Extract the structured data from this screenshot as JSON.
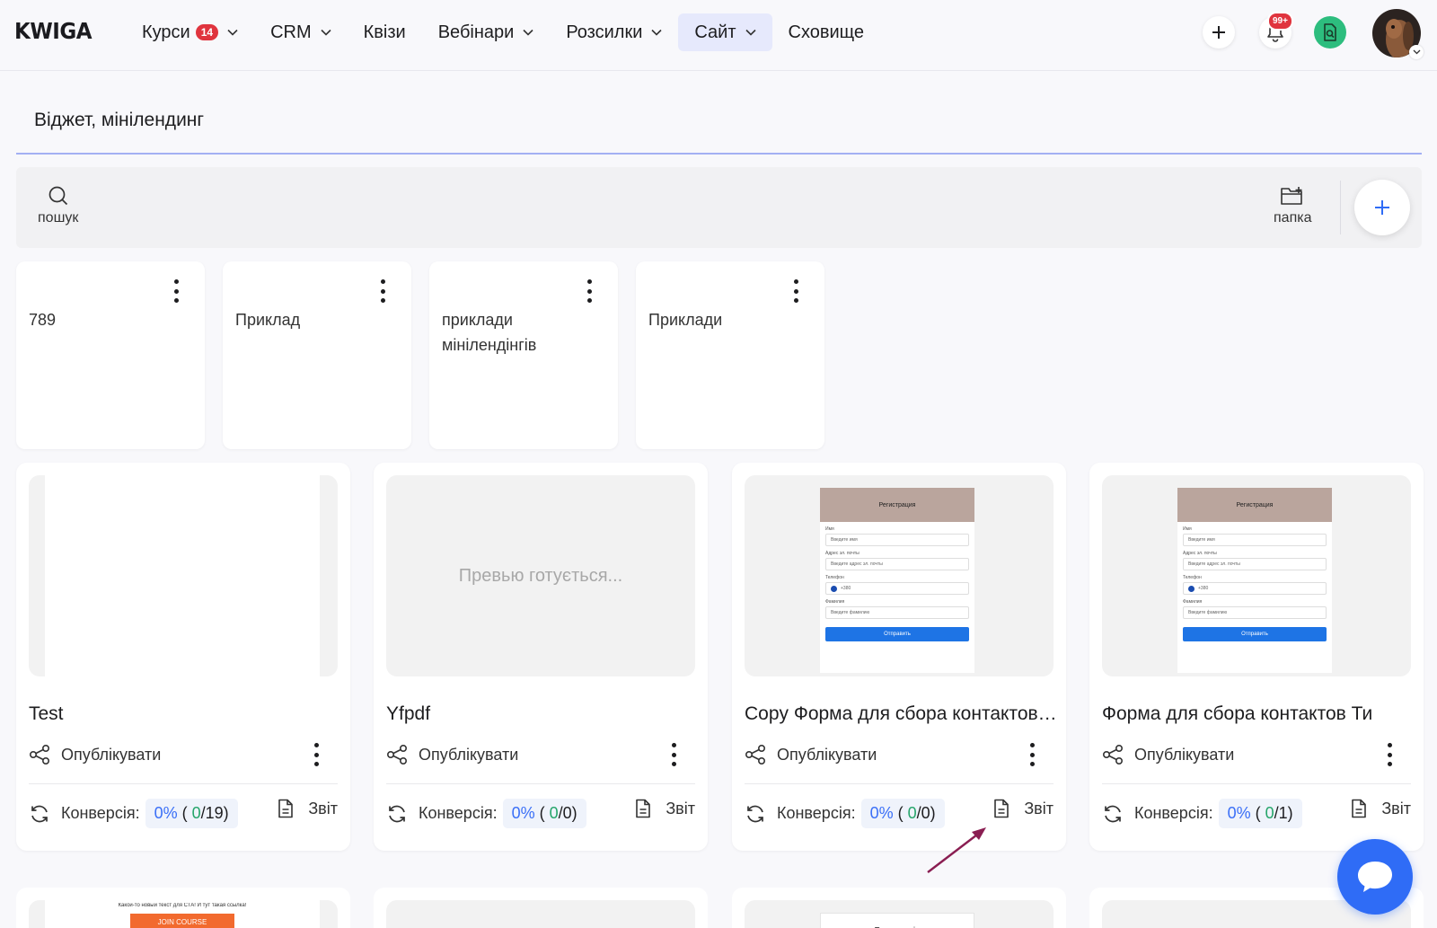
{
  "nav": {
    "logo": "KWIGA",
    "items": [
      {
        "label": "Курси",
        "badge": "14",
        "dropdown": true
      },
      {
        "label": "CRM",
        "dropdown": true
      },
      {
        "label": "Квізи"
      },
      {
        "label": "Вебінари",
        "dropdown": true
      },
      {
        "label": "Розсилки",
        "dropdown": true
      },
      {
        "label": "Сайт",
        "dropdown": true,
        "active": true
      },
      {
        "label": "Сховище"
      }
    ],
    "notifications_badge": "99+",
    "icons": [
      "plus-icon",
      "bell-icon",
      "document-search-icon",
      "avatar"
    ]
  },
  "page": {
    "title": "Віджет, мінілендинг"
  },
  "toolbar": {
    "search_label": "пошук",
    "folder_label": "папка"
  },
  "folders": [
    {
      "name": "789"
    },
    {
      "name": "Приклад"
    },
    {
      "name": "приклади мінілендінгів"
    },
    {
      "name": "Приклади"
    }
  ],
  "cards": [
    {
      "title": "Test",
      "publish": "Опублікувати",
      "conv_label": "Конверсія:",
      "pct": "0%",
      "num": "0",
      "total": "/19)",
      "report": "Звіт",
      "preview": "blank"
    },
    {
      "title": "Yfpdf",
      "publish": "Опублікувати",
      "conv_label": "Конверсія:",
      "pct": "0%",
      "num": "0",
      "total": "/0)",
      "report": "Звіт",
      "preview": "pending",
      "preview_text": "Превью готується..."
    },
    {
      "title": "Copy Форма для сбора контактов Ти",
      "publish": "Опублікувати",
      "conv_label": "Конверсія:",
      "pct": "0%",
      "num": "0",
      "total": "/0)",
      "report": "Звіт",
      "preview": "form"
    },
    {
      "title": "Форма для сбора контактов Ти",
      "publish": "Опублікувати",
      "conv_label": "Конверсія:",
      "pct": "0%",
      "num": "0",
      "total": "/1)",
      "report": "Звіт",
      "preview": "form"
    }
  ],
  "form_preview": {
    "header": "Регистрация",
    "name_label": "Имя",
    "name_ph": "Введите имя",
    "email_label": "Адрес эл. почты",
    "email_ph": "Введите адрес эл. почты",
    "phone_label": "Телефон",
    "phone_ph": "+380",
    "surname_label": "Фамилия",
    "surname_ph": "Введите фамилию",
    "submit": "Отправить"
  },
  "row2": {
    "card1_text": "Какой-то новый текст для СТА! И тут такая ссылка!",
    "card1_button": "JOIN COURSE",
    "card3_header": "Реєстрація"
  },
  "colors": {
    "accent": "#2f6cf6",
    "badge": "#e0343e",
    "active_nav": "#e6e9fc",
    "green": "#25a56a"
  }
}
